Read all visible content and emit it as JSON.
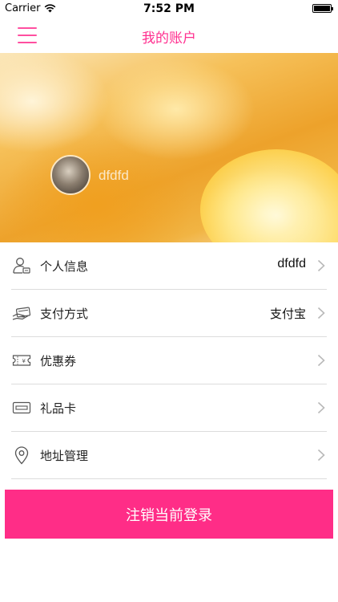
{
  "status_bar": {
    "carrier": "Carrier",
    "time": "7:52 PM",
    "wifi_icon": "wifi-icon",
    "battery_icon": "battery-icon"
  },
  "nav": {
    "title": "我的账户",
    "menu_icon": "hamburger-menu-icon",
    "accent_color": "#ff2f8f"
  },
  "profile": {
    "username": "dfdfd",
    "avatar_icon": "user-avatar"
  },
  "menu": {
    "items": [
      {
        "label": "个人信息",
        "value": "dfdfd",
        "icon": "person-id-icon"
      },
      {
        "label": "支付方式",
        "value": "支付宝",
        "icon": "payment-card-hand-icon"
      },
      {
        "label": "优惠券",
        "value": "",
        "icon": "coupon-ticket-icon"
      },
      {
        "label": "礼品卡",
        "value": "",
        "icon": "gift-card-icon"
      },
      {
        "label": "地址管理",
        "value": "",
        "icon": "location-pin-icon"
      }
    ]
  },
  "logout": {
    "label": "注销当前登录",
    "color": "#ff2d87"
  }
}
